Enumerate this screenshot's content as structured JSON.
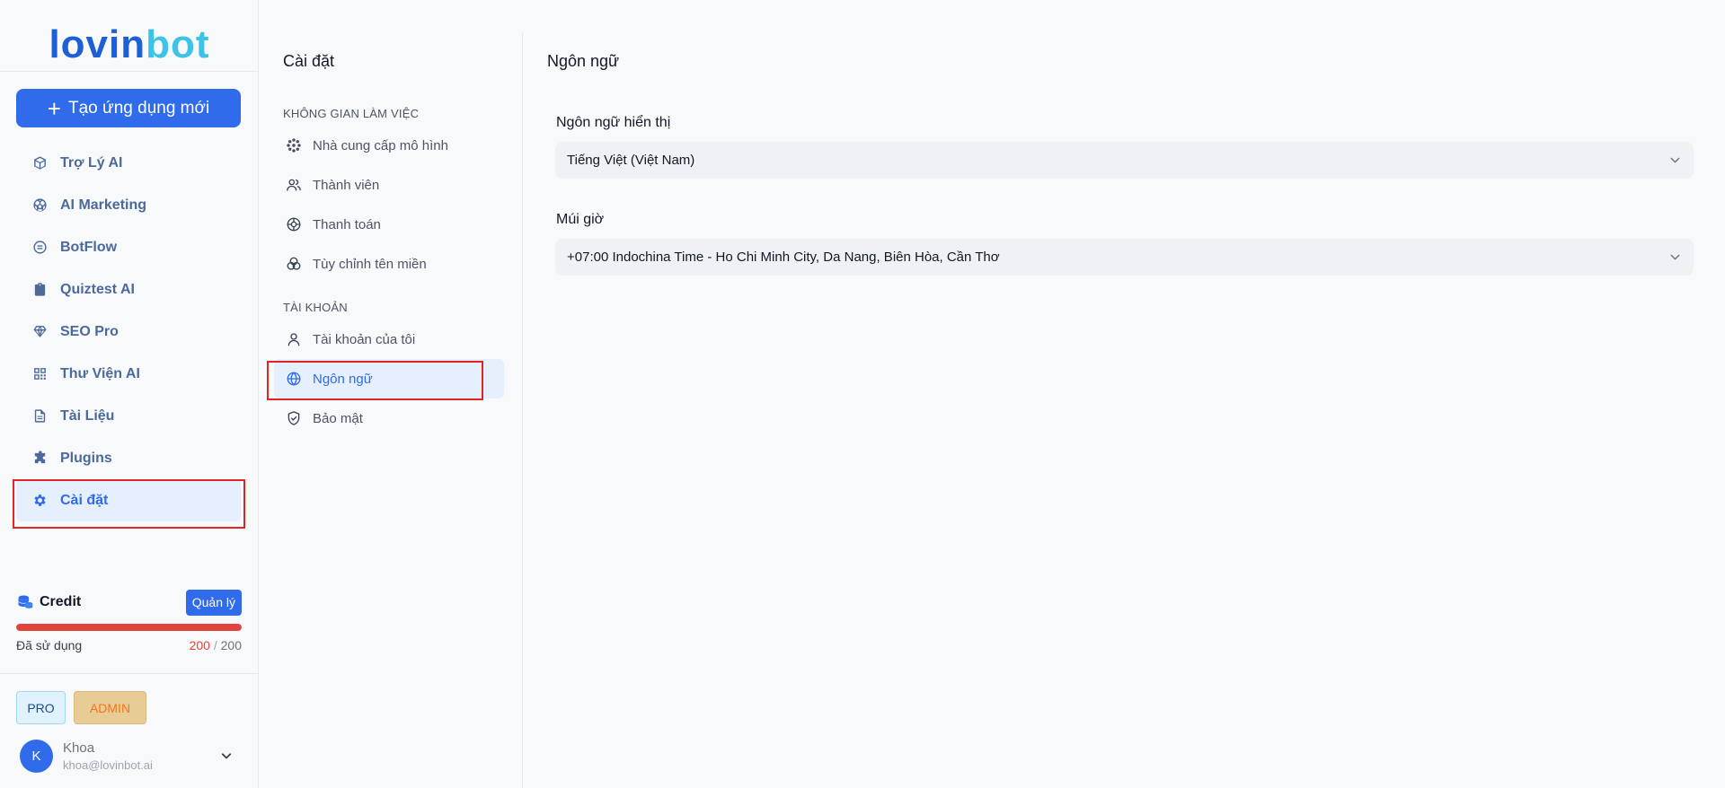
{
  "brand": {
    "logo_part1": "lovin",
    "logo_part2": "bot"
  },
  "sidebar": {
    "create_button": "Tạo ứng dụng mới",
    "items": [
      {
        "label": "Trợ Lý AI",
        "icon": "cube-icon"
      },
      {
        "label": "AI Marketing",
        "icon": "soccer-ball-icon"
      },
      {
        "label": "BotFlow",
        "icon": "message-circle-icon"
      },
      {
        "label": "Quiztest AI",
        "icon": "clipboard-icon"
      },
      {
        "label": "SEO Pro",
        "icon": "gem-icon"
      },
      {
        "label": "Thư Viện AI",
        "icon": "qrcode-icon"
      },
      {
        "label": "Tài Liệu",
        "icon": "file-icon"
      },
      {
        "label": "Plugins",
        "icon": "puzzle-icon"
      },
      {
        "label": "Cài đặt",
        "icon": "gear-icon",
        "active": true
      }
    ],
    "credit": {
      "title": "Credit",
      "manage_button": "Quản lý",
      "used_label": "Đã sử dụng",
      "used": "200",
      "separator": "/",
      "total": "200",
      "usage_fraction": 1.0
    },
    "badges": {
      "pro": "PRO",
      "admin": "ADMIN"
    },
    "user": {
      "initial": "K",
      "name": "Khoa",
      "email": "khoa@lovinbot.ai"
    }
  },
  "settings_menu": {
    "title": "Cài đặt",
    "workspace_label": "KHÔNG GIAN LÀM VIỆC",
    "workspace_items": [
      {
        "label": "Nhà cung cấp mô hình",
        "icon": "model-provider-icon"
      },
      {
        "label": "Thành viên",
        "icon": "users-icon"
      },
      {
        "label": "Thanh toán",
        "icon": "payment-icon"
      },
      {
        "label": "Tùy chỉnh tên miền",
        "icon": "domain-icon"
      }
    ],
    "account_label": "TÀI KHOẢN",
    "account_items": [
      {
        "label": "Tài khoản của tôi",
        "icon": "user-icon"
      },
      {
        "label": "Ngôn ngữ",
        "icon": "globe-icon",
        "active": true
      },
      {
        "label": "Bảo mật",
        "icon": "shield-check-icon"
      }
    ]
  },
  "content": {
    "title": "Ngôn ngữ",
    "display_language_label": "Ngôn ngữ hiển thị",
    "display_language_value": "Tiếng Việt (Việt Nam)",
    "timezone_label": "Múi giờ",
    "timezone_value": "+07:00 Indochina Time - Ho Chi Minh City, Da Nang, Biên Hòa, Cần Thơ"
  },
  "colors": {
    "primary": "#2f6bea",
    "logo_dark": "#1e5fd6",
    "logo_light": "#3ec3e8",
    "nav_text": "#4b6a9b",
    "danger": "#e0433b",
    "highlight_box": "#e02424"
  }
}
